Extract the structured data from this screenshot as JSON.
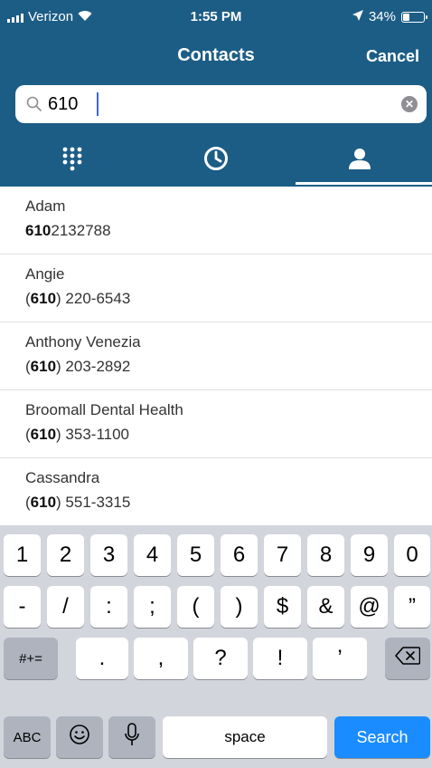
{
  "status_bar": {
    "carrier": "Verizon",
    "time": "1:55 PM",
    "battery": "34%",
    "battery_level": 0.34
  },
  "nav": {
    "title": "Contacts",
    "cancel_label": "Cancel"
  },
  "search": {
    "value": "610"
  },
  "tabs": [
    {
      "name": "keypad",
      "active": false
    },
    {
      "name": "recents",
      "active": false
    },
    {
      "name": "contacts",
      "active": true
    }
  ],
  "contacts": [
    {
      "name": "Adam",
      "phone_bold": "610",
      "phone_rest": "2132788",
      "phone_prefix": "",
      "phone_mid": ""
    },
    {
      "name": "Angie",
      "phone_prefix": "(",
      "phone_bold": "610",
      "phone_rest": ") 220-6543"
    },
    {
      "name": "Anthony Venezia",
      "phone_prefix": "(",
      "phone_bold": "610",
      "phone_rest": ") 203-2892"
    },
    {
      "name": "Broomall Dental Health",
      "phone_prefix": "(",
      "phone_bold": "610",
      "phone_rest": ") 353-1100"
    },
    {
      "name": "Cassandra",
      "phone_prefix": "(",
      "phone_bold": "610",
      "phone_rest": ") 551-3315"
    }
  ],
  "keyboard": {
    "row1": [
      "1",
      "2",
      "3",
      "4",
      "5",
      "6",
      "7",
      "8",
      "9",
      "0"
    ],
    "row2": [
      "-",
      "/",
      ":",
      ";",
      "(",
      ")",
      "$",
      "&",
      "@",
      "”"
    ],
    "row3_mode": "#+=",
    "row3": [
      ".",
      ",",
      "?",
      "!",
      "’"
    ],
    "abc_label": "ABC",
    "space_label": "space",
    "search_label": "Search"
  }
}
